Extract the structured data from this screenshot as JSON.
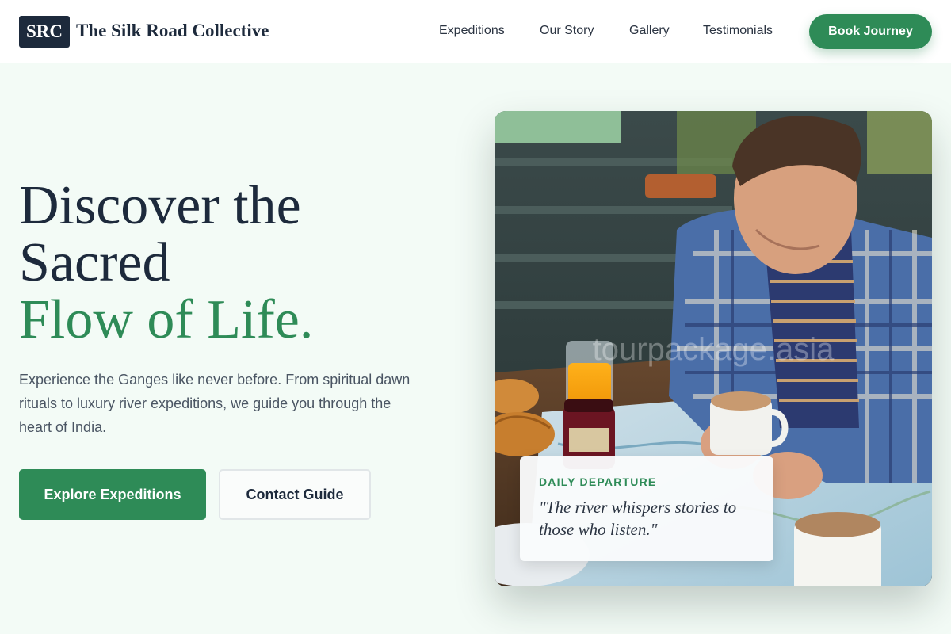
{
  "header": {
    "logo_text": "SRC",
    "brand_name": "The Silk Road Collective",
    "nav": [
      "Expeditions",
      "Our Story",
      "Gallery",
      "Testimonials"
    ],
    "cta_label": "Book Journey"
  },
  "hero": {
    "headline_lines": [
      "Discover the",
      "Sacred"
    ],
    "headline_accent": "Flow of Life.",
    "lead": "Experience the Ganges like never before. From spiritual dawn rituals to luxury river expeditions, we guide you through the heart of India.",
    "primary_button": "Explore Expeditions",
    "secondary_button": "Contact Guide"
  },
  "photo": {
    "watermark": "tourpackage.asia",
    "card_label": "DAILY DEPARTURE",
    "card_quote": "\"The river whispers stories to those who listen.\""
  },
  "colors": {
    "accent": "#2e8b57",
    "navy": "#1d2a3c",
    "background": "#f3fbf6"
  }
}
